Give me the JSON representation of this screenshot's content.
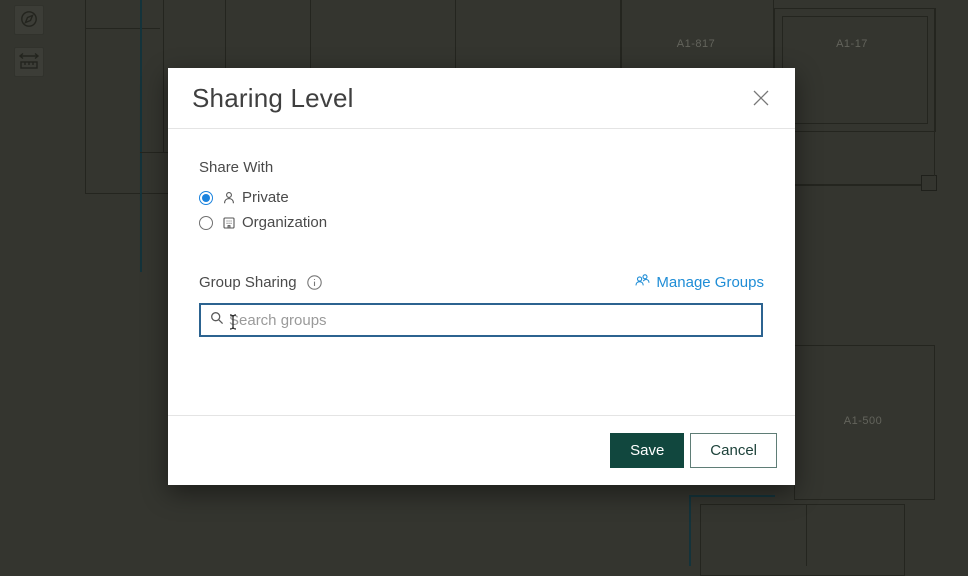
{
  "colors": {
    "map_background": "#34352f",
    "map_line": "#24251f",
    "map_teal_line": "#14333b",
    "radio_accent_blue": "#1b83de",
    "link_blue": "#1f8dd6",
    "search_focus_border": "#2c6390",
    "save_button_green": "#11473e",
    "dialog_background": "#ffffff"
  },
  "map": {
    "room_labels": [
      "A1-817",
      "A1-17",
      "A1-500"
    ]
  },
  "toolbar": {
    "buttons": [
      {
        "icon": "compass-icon"
      },
      {
        "icon": "measure-icon"
      }
    ]
  },
  "dialog": {
    "title": "Sharing Level",
    "close_icon": "close-icon",
    "share_with": {
      "label": "Share With",
      "options": [
        {
          "label": "Private",
          "icon": "person-icon",
          "selected": true
        },
        {
          "label": "Organization",
          "icon": "organization-icon",
          "selected": false
        }
      ]
    },
    "group_sharing": {
      "label": "Group Sharing",
      "info_icon": "info-icon",
      "manage_groups_label": "Manage Groups",
      "manage_groups_icon": "group-icon",
      "search_icon": "search-icon",
      "search_placeholder": "Search groups",
      "search_value": ""
    },
    "footer": {
      "save_label": "Save",
      "cancel_label": "Cancel"
    }
  }
}
